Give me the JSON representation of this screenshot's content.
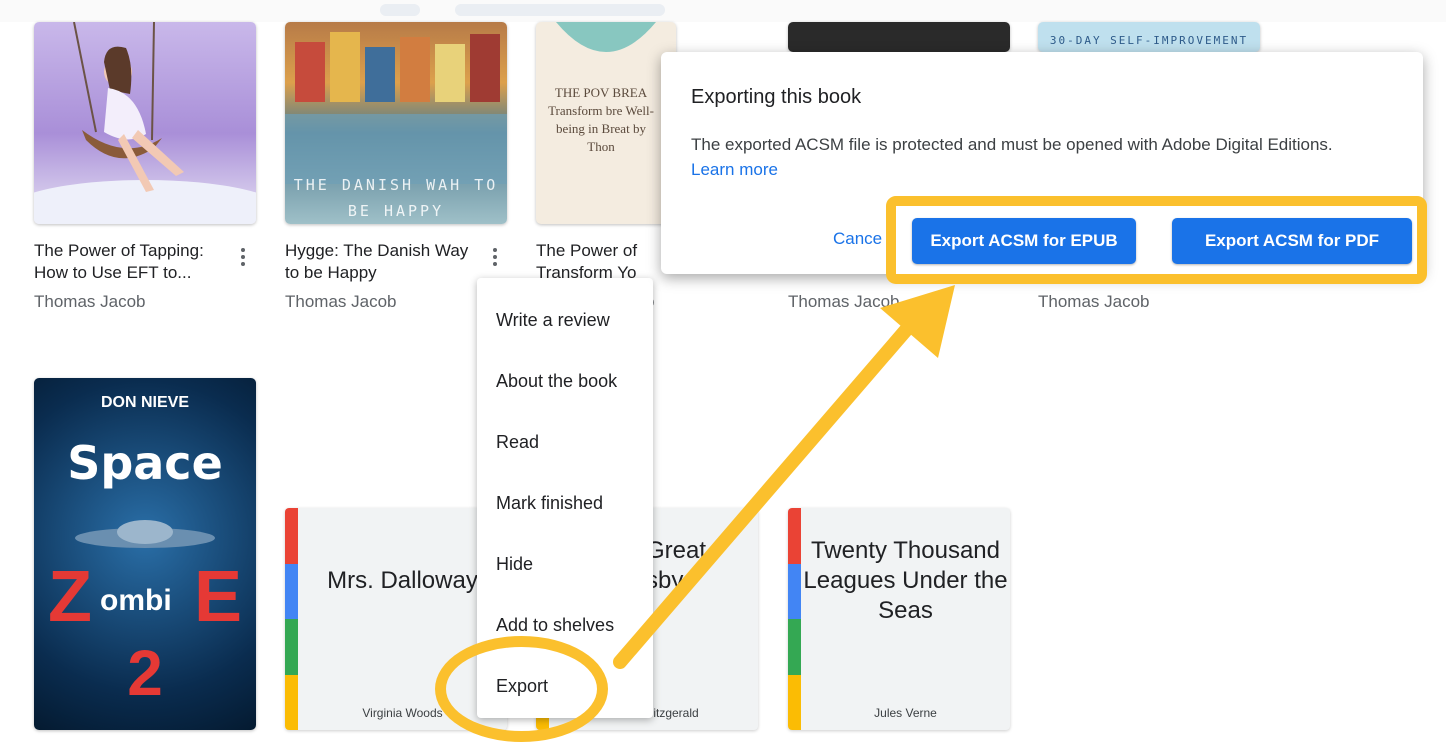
{
  "books_row1": [
    {
      "title": "The Power of Tapping: How to Use EFT to...",
      "author": "Thomas Jacob"
    },
    {
      "title": "Hygge: The Danish Way to be Happy",
      "author": "Thomas Jacob",
      "cover_text": "THE DANISH WAH TO BE HAPPY"
    },
    {
      "title": "The Power of Transform Yo",
      "author": "o",
      "cover_text": "THE POV BREA Transform bre Well-being in Breat by Thon"
    },
    {
      "title": "",
      "author": "Thomas Jacob"
    },
    {
      "title": "",
      "author": "Thomas Jacob",
      "cover_text": "30-DAY SELF-IMPROVEMENT"
    }
  ],
  "books_row2": [
    {
      "cover_top": "DON NIEVE",
      "cover_main": "Space",
      "cover_z": "Z",
      "cover_ombi": "ombi",
      "cover_e": "E",
      "cover_num": "2"
    },
    {
      "cover_title": "Mrs. Dalloway",
      "cover_author": "Virginia Woods"
    },
    {
      "cover_title": "Great sby",
      "cover_author": "Fitzgerald"
    },
    {
      "cover_title": "Twenty Thousand Leagues Under the Seas",
      "cover_author": "Jules Verne"
    }
  ],
  "context_menu": {
    "items": [
      "Write a review",
      "About the book",
      "Read",
      "Mark finished",
      "Hide",
      "Add to shelves",
      "Export"
    ]
  },
  "export_dialog": {
    "title": "Exporting this book",
    "body": "The exported ACSM file is protected and must be opened with Adobe Digital Editions.",
    "link": "Learn more",
    "cancel_label": "Cance",
    "epub_button": "Export ACSM for EPUB",
    "pdf_button": "Export ACSM for PDF"
  },
  "colors": {
    "highlight": "#fbc02d",
    "primary": "#1a73e8",
    "stripe": [
      "#ea4335",
      "#4285f4",
      "#34a853",
      "#fbbc04"
    ]
  },
  "icons": {
    "more": "kebab-icon",
    "arrow": "pointer-arrow"
  }
}
